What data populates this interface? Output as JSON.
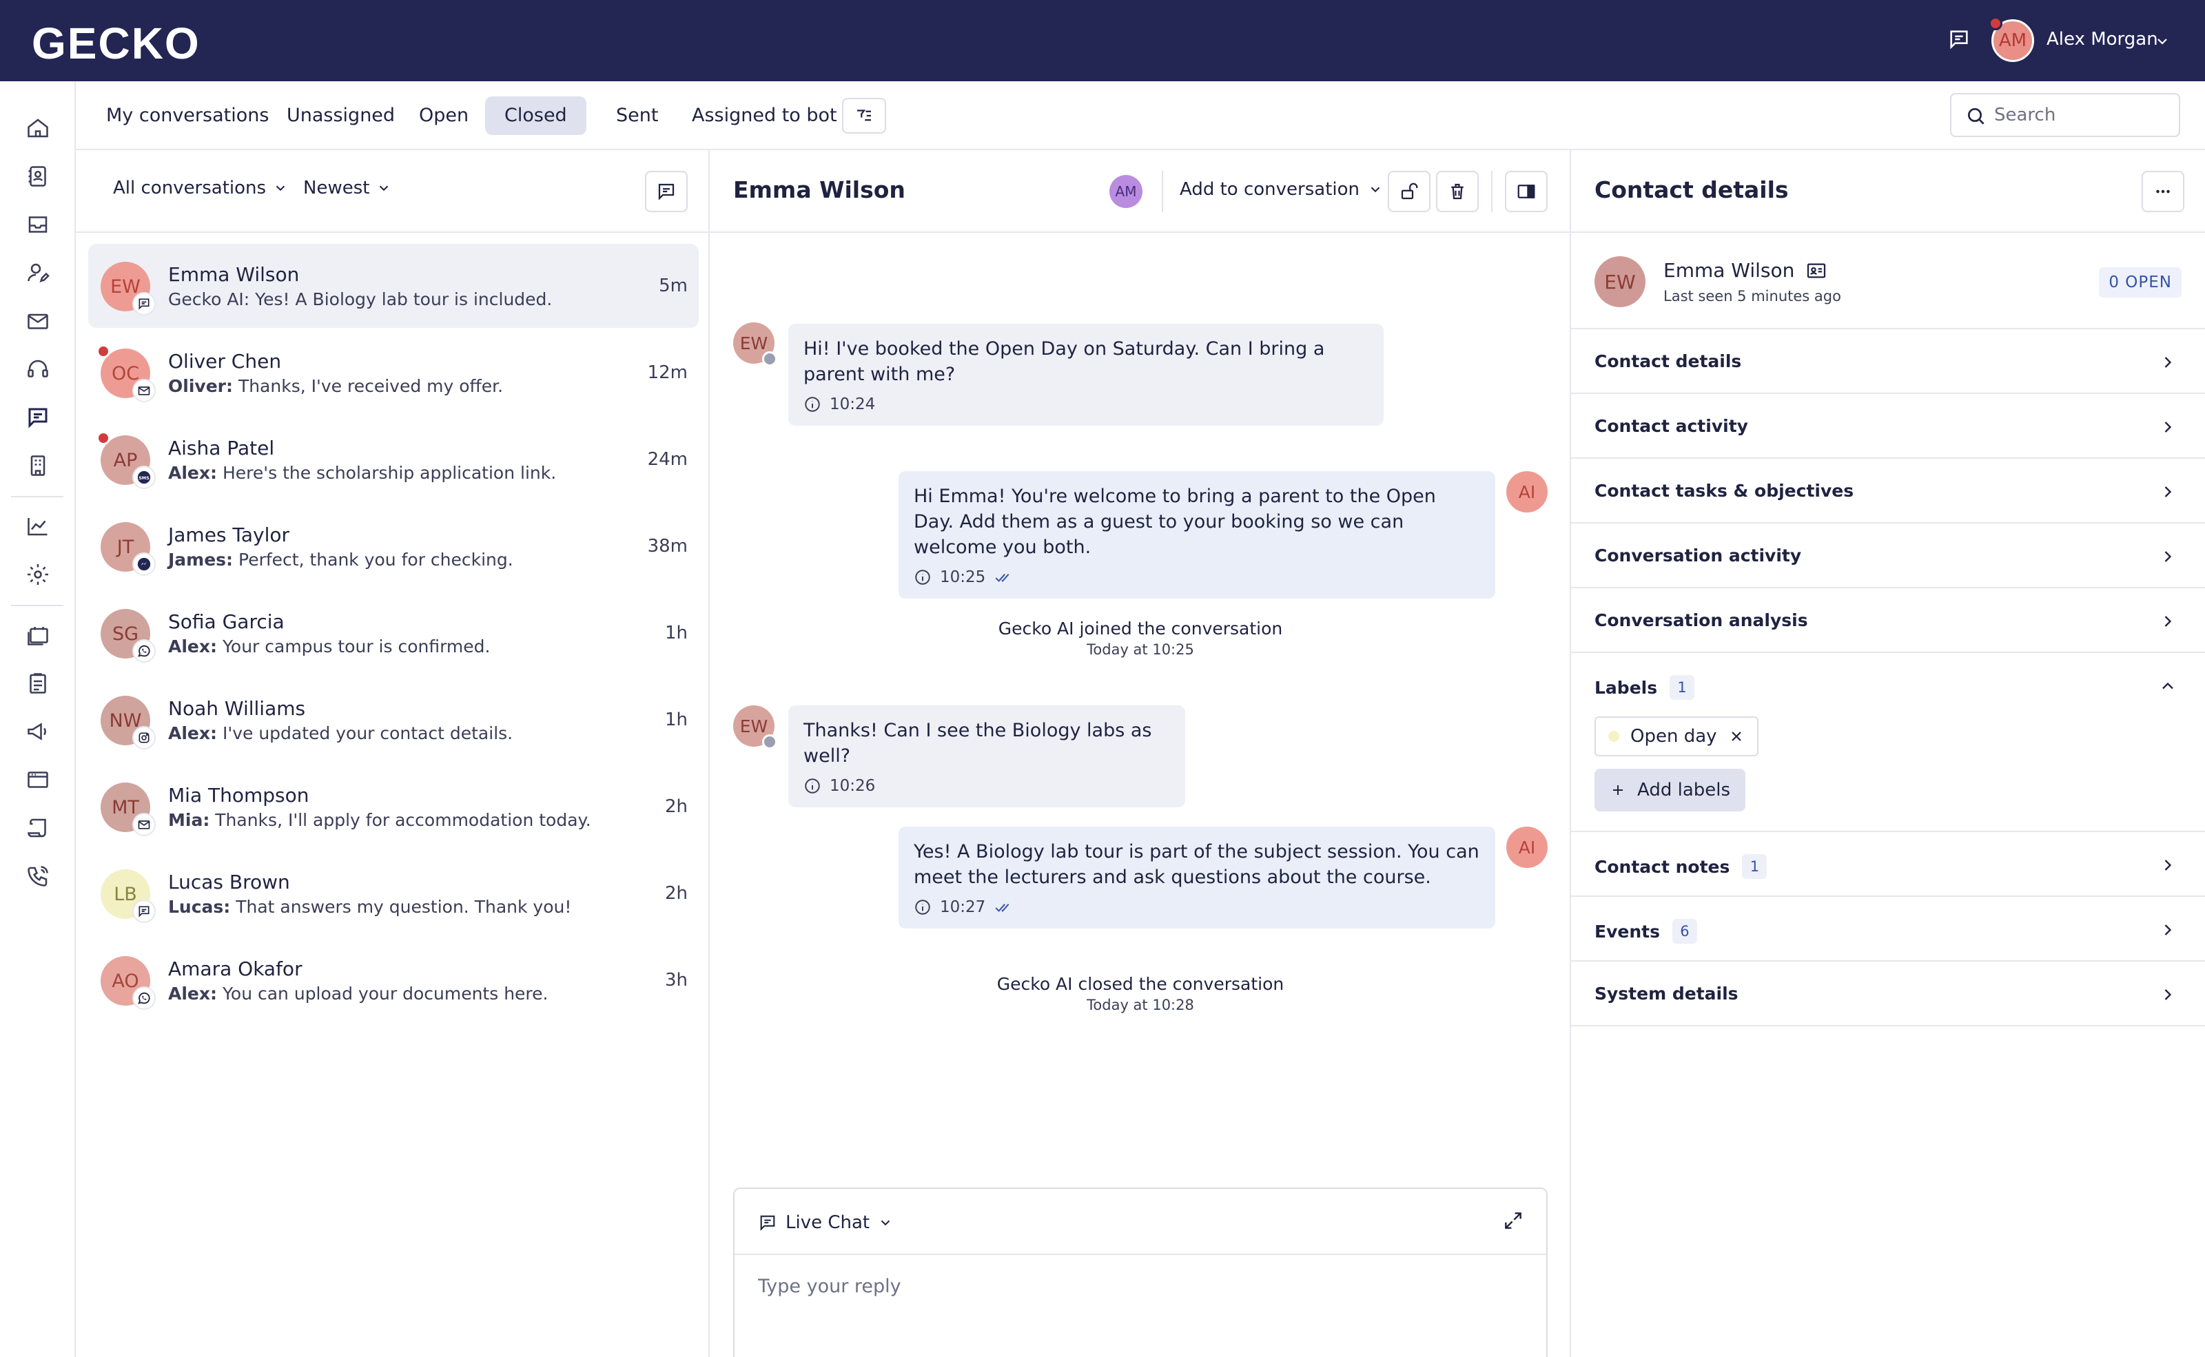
{
  "app": {
    "logo": "GECKO",
    "user_name": "Alex Morgan",
    "user_initials": "AM"
  },
  "tabs": [
    {
      "label": "My conversations",
      "active": false
    },
    {
      "label": "Unassigned",
      "active": false
    },
    {
      "label": "Open",
      "active": false
    },
    {
      "label": "Closed",
      "active": true
    },
    {
      "label": "Sent",
      "active": false
    },
    {
      "label": "Assigned to bot",
      "active": false
    }
  ],
  "search": {
    "placeholder": "Search",
    "value": ""
  },
  "list": {
    "filter_label": "All conversations",
    "sort_label": "Newest",
    "items": [
      {
        "initials": "EW",
        "name": "Emma Wilson",
        "sender": "",
        "preview": "Gecko AI: Yes! A Biology lab tour is included.",
        "time": "5m",
        "channel": "chat-icon",
        "unread": false,
        "active": true,
        "avatar_bg": "#ee9c93",
        "avatar_fg": "#b5433a"
      },
      {
        "initials": "OC",
        "name": "Oliver Chen",
        "sender": "Oliver:",
        "preview": "Thanks, I've received my offer.",
        "time": "12m",
        "channel": "email-icon",
        "unread": true,
        "active": false,
        "avatar_bg": "#ee9c93",
        "avatar_fg": "#b5433a"
      },
      {
        "initials": "AP",
        "name": "Aisha Patel",
        "sender": "Alex:",
        "preview": "Here's the scholarship application link.",
        "time": "24m",
        "channel": "sms-icon",
        "unread": true,
        "active": false,
        "avatar_bg": "#d7a49d",
        "avatar_fg": "#8a3c36"
      },
      {
        "initials": "JT",
        "name": "James Taylor",
        "sender": "James:",
        "preview": "Perfect, thank you for checking.",
        "time": "38m",
        "channel": "messenger-icon",
        "unread": false,
        "active": false,
        "avatar_bg": "#d7a49d",
        "avatar_fg": "#8a3c36"
      },
      {
        "initials": "SG",
        "name": "Sofia Garcia",
        "sender": "Alex:",
        "preview": "Your campus tour is confirmed.",
        "time": "1h",
        "channel": "whatsapp-icon",
        "unread": false,
        "active": false,
        "avatar_bg": "#cfa49d",
        "avatar_fg": "#8a3c36"
      },
      {
        "initials": "NW",
        "name": "Noah Williams",
        "sender": "Alex:",
        "preview": "I've updated your contact details.",
        "time": "1h",
        "channel": "instagram-icon",
        "unread": false,
        "active": false,
        "avatar_bg": "#cfa49d",
        "avatar_fg": "#8a3c36"
      },
      {
        "initials": "MT",
        "name": "Mia Thompson",
        "sender": "Mia:",
        "preview": "Thanks, I'll apply for accommodation today.",
        "time": "2h",
        "channel": "email-icon",
        "unread": false,
        "active": false,
        "avatar_bg": "#cfa49d",
        "avatar_fg": "#8a3c36"
      },
      {
        "initials": "LB",
        "name": "Lucas Brown",
        "sender": "Lucas:",
        "preview": "That answers my question. Thank you!",
        "time": "2h",
        "channel": "chat-icon",
        "unread": false,
        "active": false,
        "avatar_bg": "#f3f0c4",
        "avatar_fg": "#8a8440"
      },
      {
        "initials": "AO",
        "name": "Amara Okafor",
        "sender": "Alex:",
        "preview": "You can upload your documents here.",
        "time": "3h",
        "channel": "whatsapp-icon",
        "unread": false,
        "active": false,
        "avatar_bg": "#e7a59d",
        "avatar_fg": "#a5453c"
      }
    ]
  },
  "chat": {
    "title": "Emma Wilson",
    "assignee_initials": "AM",
    "add_to_conversation": "Add to conversation",
    "messages": [
      {
        "initials": "EW",
        "text": "Hi! I've booked the Open Day on Saturday. Can I bring a parent with me?",
        "time": "10:24"
      },
      {
        "initials": "AI",
        "text": "Hi Emma! You're welcome to bring a parent to the Open Day. Add them as a guest to your booking so we can welcome you both.",
        "time": "10:25"
      },
      {
        "initials": "EW",
        "text": "Thanks! Can I see the Biology labs as well?",
        "time": "10:26"
      },
      {
        "initials": "AI",
        "text": "Yes! A Biology lab tour is part of the subject session. You can meet the lecturers and ask questions about the course.",
        "time": "10:27"
      }
    ],
    "events": [
      {
        "title": "Gecko AI joined the conversation",
        "time": "Today at 10:25"
      },
      {
        "title": "Gecko AI closed the conversation",
        "time": "Today at 10:28"
      }
    ],
    "composer": {
      "channel": "Live Chat",
      "placeholder": "Type your reply",
      "value": ""
    }
  },
  "contact": {
    "panel_title": "Contact details",
    "initials": "EW",
    "name": "Emma Wilson",
    "last_seen": "Last seen 5 minutes ago",
    "open_badge": "0 OPEN",
    "sections": [
      {
        "title": "Contact details",
        "count": ""
      },
      {
        "title": "Contact activity",
        "count": ""
      },
      {
        "title": "Contact tasks & objectives",
        "count": ""
      },
      {
        "title": "Conversation activity",
        "count": ""
      },
      {
        "title": "Conversation analysis",
        "count": ""
      }
    ],
    "labels": {
      "title": "Labels",
      "count": "1",
      "items": [
        "Open day"
      ],
      "add_label": "Add labels"
    },
    "sections_after": [
      {
        "title": "Contact notes",
        "count": "1"
      },
      {
        "title": "Events",
        "count": "6"
      },
      {
        "title": "System details",
        "count": ""
      }
    ]
  },
  "colors": {
    "topbar": "#232653",
    "accent_blue": "#3452a8",
    "active_tab": "#dfe2ee",
    "unread_dot": "#d23b3b",
    "ai_avatar": "#ef9a90"
  }
}
